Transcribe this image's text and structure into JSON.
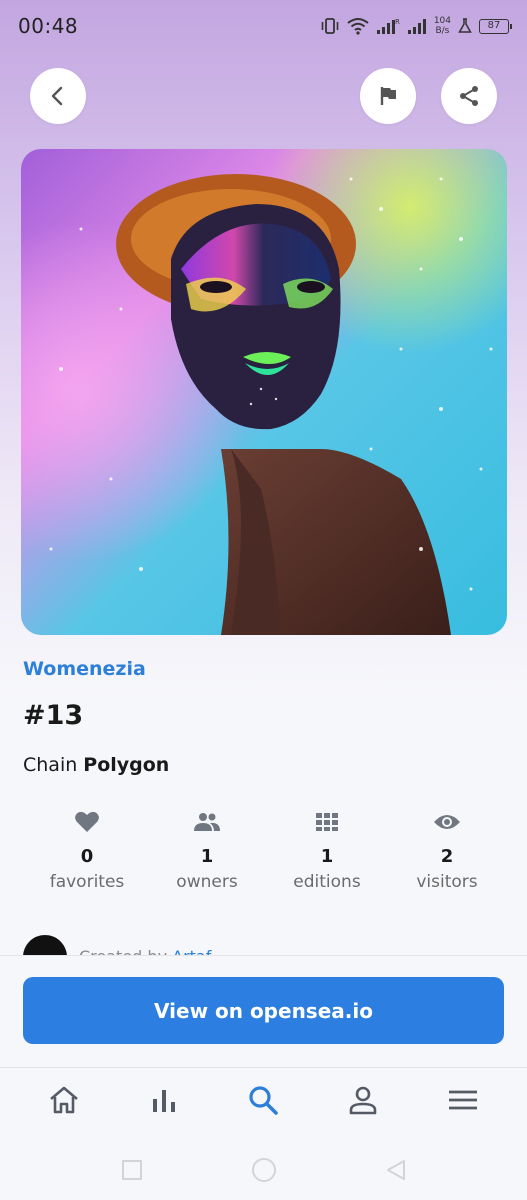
{
  "status_bar": {
    "time": "00:48",
    "net_speed_value": "104",
    "net_speed_unit": "B/s",
    "battery": "87"
  },
  "collection": {
    "name": "Womenezia"
  },
  "token": {
    "title": "#13",
    "chain_label": "Chain",
    "chain_value": "Polygon"
  },
  "stats": [
    {
      "icon": "heart-icon",
      "count": "0",
      "label": "favorites"
    },
    {
      "icon": "people-icon",
      "count": "1",
      "label": "owners"
    },
    {
      "icon": "grid-icon",
      "count": "1",
      "label": "editions"
    },
    {
      "icon": "eye-icon",
      "count": "2",
      "label": "visitors"
    }
  ],
  "creator": {
    "prefix": "Created by",
    "name": "Artaf..."
  },
  "cta": {
    "label": "View on opensea.io"
  },
  "colors": {
    "accent": "#2c7fe0",
    "link": "#2d7fd8",
    "nav_active": "#2d7fd8",
    "nav_inactive": "#555b66"
  },
  "bottom_nav": [
    "home-icon",
    "chart-icon",
    "search-icon",
    "profile-icon",
    "menu-icon"
  ]
}
